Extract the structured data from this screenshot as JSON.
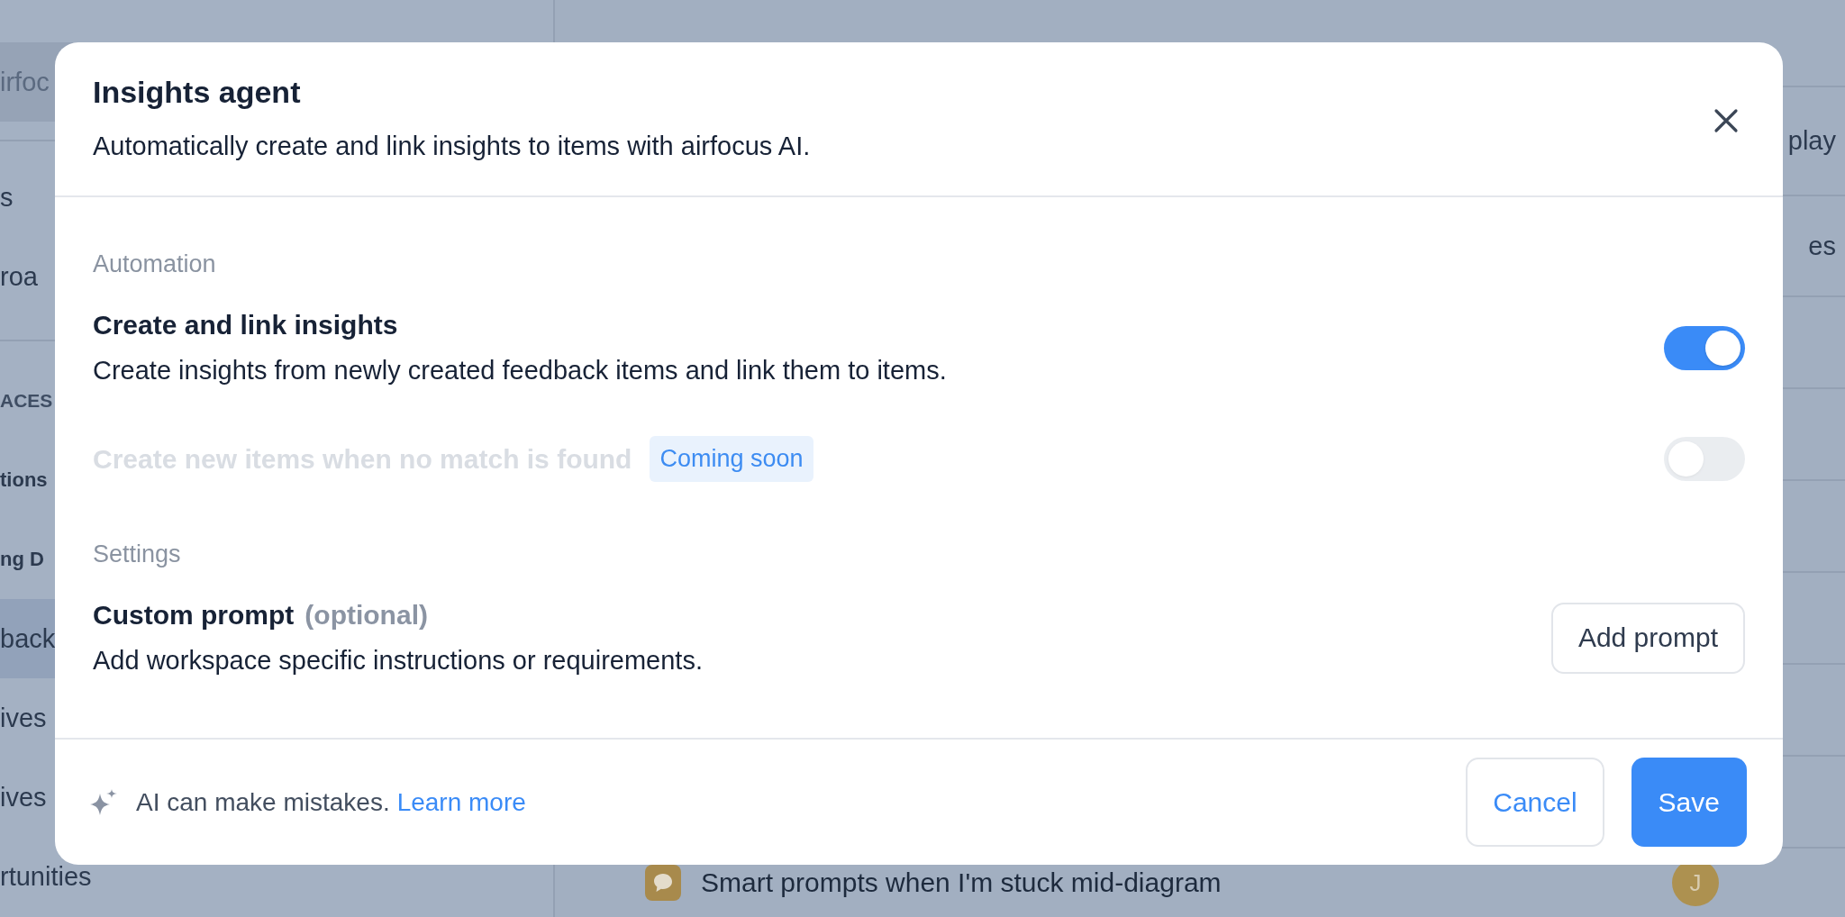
{
  "sidebar": {
    "search": "irfoc",
    "groups": [
      {
        "items": [
          {
            "text": "s",
            "kind": "item",
            "selected": false
          },
          {
            "text": "roa",
            "kind": "item",
            "selected": false
          }
        ]
      },
      {
        "items": [
          {
            "text": "ACES",
            "kind": "section",
            "selected": false
          },
          {
            "text": "tions",
            "kind": "group",
            "selected": false
          },
          {
            "text": "ng D",
            "kind": "group",
            "selected": false
          },
          {
            "text": "back",
            "kind": "item",
            "selected": true
          },
          {
            "text": "ives",
            "kind": "item",
            "selected": false
          },
          {
            "text": "ives",
            "kind": "item",
            "selected": false
          },
          {
            "text": "rtunities",
            "kind": "item",
            "selected": false
          }
        ]
      }
    ]
  },
  "main": {
    "column_fragments": [
      "play",
      "es"
    ],
    "row": {
      "title": "Smart prompts when I'm stuck mid-diagram",
      "avatar": "J"
    }
  },
  "dialog": {
    "title": "Insights agent",
    "subtitle": "Automatically create and link insights to items with airfocus AI.",
    "sections": [
      {
        "heading": "Automation",
        "options": [
          {
            "kind": "toggle",
            "title": "Create and link insights",
            "description": "Create insights from newly created feedback items and link them to items.",
            "on": true,
            "disabled": false
          },
          {
            "kind": "toggle",
            "title": "Create new items when no match is found",
            "badge": "Coming soon",
            "on": false,
            "disabled": true
          }
        ]
      },
      {
        "heading": "Settings",
        "options": [
          {
            "kind": "button",
            "title": "Custom prompt",
            "note": "(optional)",
            "description": "Add workspace specific instructions or requirements.",
            "button": "Add prompt"
          }
        ]
      }
    ],
    "footer": {
      "notice": "AI can make mistakes.",
      "link": "Learn more",
      "buttons": [
        {
          "label": "Cancel",
          "kind": "secondary"
        },
        {
          "label": "Save",
          "kind": "primary"
        }
      ]
    }
  }
}
